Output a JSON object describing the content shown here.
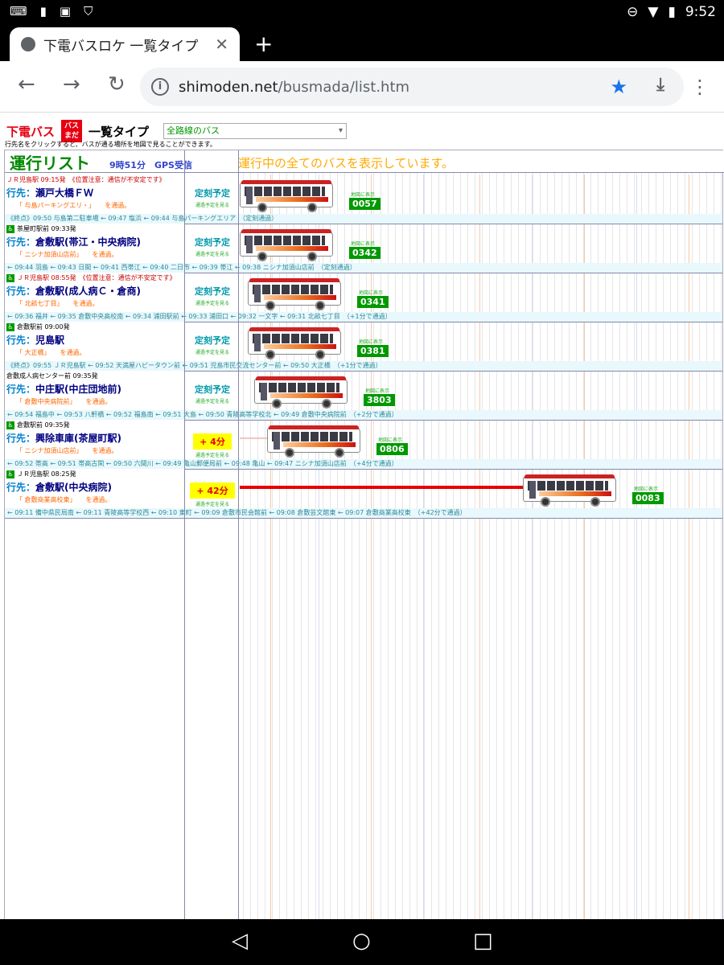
{
  "status_bar": {
    "time": "9:52",
    "left_icons": [
      "keyboard-icon",
      "sim-icon",
      "image-icon",
      "shield-icon"
    ]
  },
  "browser": {
    "tab_title": "下電バスロケ 一覧タイプ",
    "url_host": "shimoden.net",
    "url_path": "/busmada/list.htm"
  },
  "page": {
    "brand": "下電バス",
    "logo_text": "バス\nまだ",
    "list_type": "一覧タイプ",
    "route_select": "全路線のバス",
    "hint": "行先名をクリックすると、バスが通る場所を地図で見ることができます。",
    "board_title": "運行リスト",
    "board_time": "9時51分　GPS受信",
    "board_msg": "運行中の全てのバスを表示しています。"
  },
  "rows": [
    {
      "origin": "ＪＲ児島駅 09:15発　《位置注意：通信が不安定です》",
      "warn": true,
      "wc": false,
      "dest_label": "行先：",
      "dest": "瀬戸大橋ＦＷ",
      "via": "「 与島パーキングエリ・」",
      "via_tail": "を通過。",
      "status": "定刻予定",
      "delay": false,
      "sub": "通過予定を見る",
      "bus_number": "0057",
      "map_label": "地図に表示",
      "stops": "《終点》09:50 与島第二駐車場 ← 09:47 塩浜 ← 09:44 与島パーキングエリア　（定刻通過）"
    },
    {
      "origin": "茶屋町駅前 09:33発",
      "warn": false,
      "wc": true,
      "dest_label": "行先：",
      "dest": "倉敷駅(帯江・中央病院)",
      "via": "「 ニシナ加須山店前」",
      "via_tail": "を通過。",
      "status": "定刻予定",
      "delay": false,
      "sub": "通過予定を見る",
      "bus_number": "0342",
      "map_label": "地図に表示",
      "stops": "← 09:44 羽島 ← 09:43 日間 ← 09:41 西帯江 ← 09:40 二日市 ← 09:39 帯江 ← 09:38 ニシナ加須山店前　（定刻通過）"
    },
    {
      "origin": "ＪＲ児島駅 08:55発　《位置注意：通信が不安定です》",
      "warn": true,
      "wc": true,
      "dest_label": "行先：",
      "dest": "倉敷駅(成人病Ｃ・倉商)",
      "via": "「 北畝七丁目」",
      "via_tail": "を通過。",
      "status": "定刻予定",
      "delay": false,
      "sub": "通過予定を見る",
      "bus_number": "0341",
      "map_label": "地図に表示",
      "stops": "← 09:36 福井 ← 09:35 倉敷中央高校南 ← 09:34 浦田駅前 ← 09:33 浦田口 ← 09:32 一文字 ← 09:31 北畝七丁目　（+1分で通過）"
    },
    {
      "origin": "倉敷駅前 09:00発",
      "warn": false,
      "wc": true,
      "dest_label": "行先：",
      "dest": "児島駅",
      "via": "「 大正橋」",
      "via_tail": "を通過。",
      "status": "定刻予定",
      "delay": false,
      "sub": "通過予定を見る",
      "bus_number": "0381",
      "map_label": "地図に表示",
      "stops": "《終点》09:55 ＪＲ児島駅 ← 09:52 天満屋ハピータウン前 ← 09:51 児島市民交流センター前 ← 09:50 大正橋　（+1分で通過）"
    },
    {
      "origin": "倉敷成人病センター前 09:35発",
      "warn": false,
      "wc": false,
      "dest_label": "行先：",
      "dest": "中庄駅(中庄団地前)",
      "via": "「 倉敷中央病院前」",
      "via_tail": "を通過。",
      "status": "定刻予定",
      "delay": false,
      "sub": "通過予定を見る",
      "bus_number": "3803",
      "map_label": "地図に表示",
      "stops": "← 09:54 福島中 ← 09:53 八軒橋 ← 09:52 福島南 ← 09:51 大島 ← 09:50 青陵高等学校北 ← 09:49 倉敷中央病院前　（+2分で通過）"
    },
    {
      "origin": "倉敷駅前 09:35発",
      "warn": false,
      "wc": true,
      "dest_label": "行先：",
      "dest": "興除車庫(茶屋町駅)",
      "via": "「 ニシナ加須山店前」",
      "via_tail": "を通過。",
      "status": "+ 4分",
      "delay": true,
      "sub": "通過予定を見る",
      "bus_number": "0806",
      "map_label": "地図に表示",
      "stops": "← 09:52 帯高 ← 09:51 帯高古閑 ← 09:50 六間川 ← 09:49 亀山郵便局前 ← 09:48 亀山 ← 09:47 ニシナ加須山店前　（+4分で通過）"
    },
    {
      "origin": "ＪＲ児島駅 08:25発",
      "warn": false,
      "wc": true,
      "dest_label": "行先：",
      "dest": "倉敷駅(中央病院)",
      "via": "「 倉敷商業高校東」",
      "via_tail": "を通過。",
      "status": "+ 42分",
      "delay": true,
      "sub": "通過予定を見る",
      "bus_number": "0083",
      "map_label": "地図に表示",
      "stops": "← 09:11 備中県民局南 ← 09:11 青陵高等学校西 ← 09:10 東町 ← 09:09 倉敷市民会館前 ← 09:08 倉敷芸文館東 ← 09:07 倉敷商業高校東　（+42分で通過）"
    }
  ]
}
